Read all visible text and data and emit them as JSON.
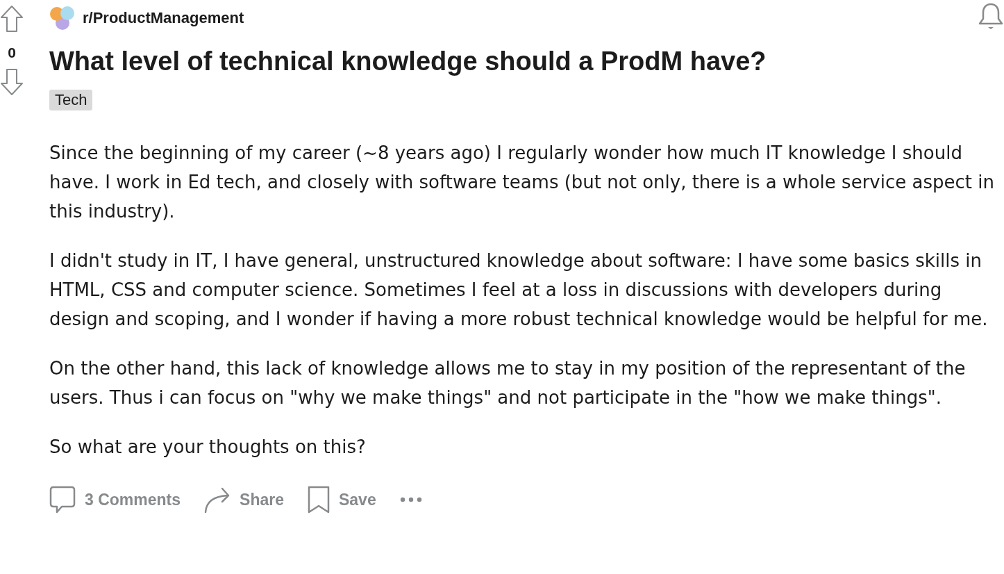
{
  "vote": {
    "score": "0"
  },
  "subreddit": {
    "name": "r/ProductManagement"
  },
  "post": {
    "title": "What level of technical knowledge should a ProdM have?",
    "flair": "Tech",
    "paragraphs": [
      "Since the beginning of my career (~8 years ago) I regularly wonder how much IT knowledge I should have. I work in Ed tech, and closely with software teams (but not only, there is a whole service aspect in this industry).",
      "I didn't study in IT, I have general, unstructured knowledge about software: I have some basics skills in HTML, CSS and computer science. Sometimes I feel at a loss in discussions with developers during design and scoping, and I wonder if having a more robust technical knowledge would be helpful for me.",
      "On the other hand, this lack of knowledge allows me to stay in my position of the representant of the users. Thus i can focus on \"why we make things\" and not participate in the \"how we make things\".",
      "So what are your thoughts on this?"
    ]
  },
  "actions": [
    {
      "kind": "comments",
      "label": "3 Comments"
    },
    {
      "kind": "share",
      "label": "Share"
    },
    {
      "kind": "save",
      "label": "Save"
    },
    {
      "kind": "more"
    }
  ]
}
